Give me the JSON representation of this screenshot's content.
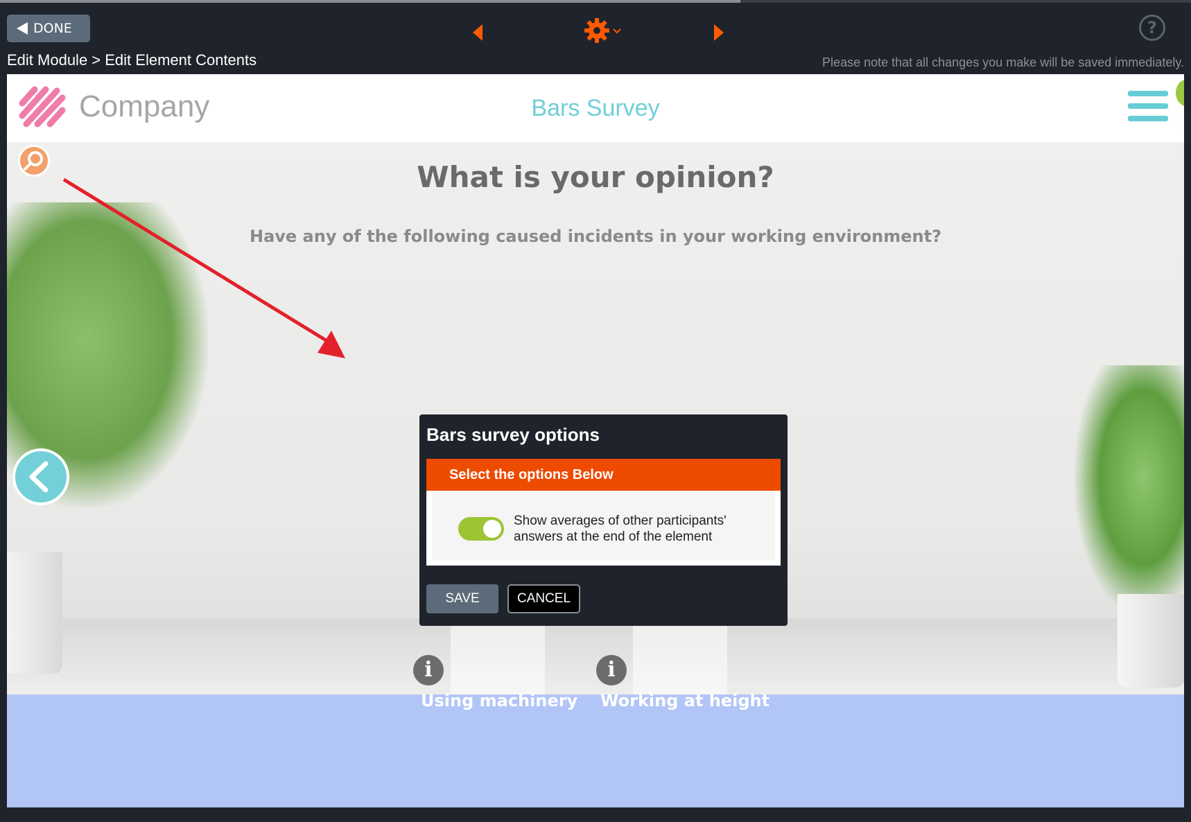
{
  "toolbar": {
    "done_label": "DONE",
    "breadcrumb": "Edit Module > Edit Element Contents",
    "note": "Please note that all changes you make will be saved immediately.",
    "icons": [
      "prev-arrow-icon",
      "gear-icon",
      "next-arrow-icon",
      "help-icon"
    ],
    "accent_color": "#ff5a00"
  },
  "header": {
    "company": "Company",
    "survey_title": "Bars Survey",
    "title_color": "#6fcfd6"
  },
  "content": {
    "question": "What is your opinion?",
    "subquestion": "Have any of the following caused incidents in your working environment?",
    "bars": [
      {
        "label": "Using machinery"
      },
      {
        "label": "Working at height"
      }
    ]
  },
  "modal": {
    "title": "Bars survey options",
    "section_title": "Select the options Below",
    "toggle_label": "Show averages of other participants' answers at the end of the element",
    "toggle_on": true,
    "save_label": "SAVE",
    "cancel_label": "CANCEL",
    "section_color": "#ee4b00",
    "toggle_color": "#9cc534"
  }
}
